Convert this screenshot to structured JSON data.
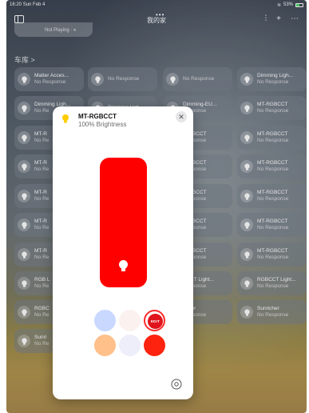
{
  "status_bar": {
    "time": "16:20",
    "date": "Sun Feb 4",
    "battery": "53%",
    "dots": "•••"
  },
  "nav": {
    "title": "我的家"
  },
  "top_card": {
    "status": "Not Playing · ⏸"
  },
  "section": {
    "title": "车库 >"
  },
  "tiles": [
    {
      "name": "Matter Acces...",
      "status": "No Response"
    },
    {
      "name": "",
      "status": "No Response"
    },
    {
      "name": "",
      "status": "No Response"
    },
    {
      "name": "Dimming Ligh...",
      "status": "No Response"
    },
    {
      "name": "Dimming Ligh...",
      "status": "No Re"
    },
    {
      "name": "Dimming Ligh",
      "status": ""
    },
    {
      "name": "Dimming-EU...",
      "status": "Response"
    },
    {
      "name": "MT-RGBCCT",
      "status": "No Response"
    },
    {
      "name": "MT-R",
      "status": "No Re"
    },
    {
      "name": "",
      "status": ""
    },
    {
      "name": "-RGBCCT",
      "status": "Response"
    },
    {
      "name": "MT-RGBCCT",
      "status": "No Response"
    },
    {
      "name": "MT-R",
      "status": "No Re"
    },
    {
      "name": "",
      "status": ""
    },
    {
      "name": "-RGBCCT",
      "status": "Response"
    },
    {
      "name": "MT-RGBCCT",
      "status": "No Response"
    },
    {
      "name": "MT-R",
      "status": "No Re"
    },
    {
      "name": "",
      "status": ""
    },
    {
      "name": "-RGBCCT",
      "status": "Response"
    },
    {
      "name": "MT-RGBCCT",
      "status": "No Response"
    },
    {
      "name": "MT-R",
      "status": "No Re"
    },
    {
      "name": "",
      "status": ""
    },
    {
      "name": "-RGBCCT",
      "status": "Response"
    },
    {
      "name": "MT-RGBCCT",
      "status": "No Response"
    },
    {
      "name": "MT-R",
      "status": "No Re"
    },
    {
      "name": "",
      "status": ""
    },
    {
      "name": "-RGBCCT",
      "status": "Response"
    },
    {
      "name": "MT-RGBCCT",
      "status": "No Response"
    },
    {
      "name": "RGB L",
      "status": "No Re"
    },
    {
      "name": "",
      "status": ""
    },
    {
      "name": "BCCT Light...",
      "status": "Response"
    },
    {
      "name": "RGBCCT Light...",
      "status": "No Response"
    },
    {
      "name": "RGBC",
      "status": "No Re"
    },
    {
      "name": "",
      "status": ""
    },
    {
      "name": "richer",
      "status": "Response"
    },
    {
      "name": "Sunricher",
      "status": "No Response"
    },
    {
      "name": "Sunri",
      "status": "No Re"
    }
  ],
  "modal": {
    "title": "MT-RGBCCT",
    "subtitle": "100% Brightness",
    "brightness": 1.0,
    "edit_label": "EDIT",
    "swatches": [
      "#c9d8ff",
      "#fbf1ee",
      "#ff2a2a",
      "#ffc089",
      "#eeeefb",
      "#fe230f"
    ]
  }
}
